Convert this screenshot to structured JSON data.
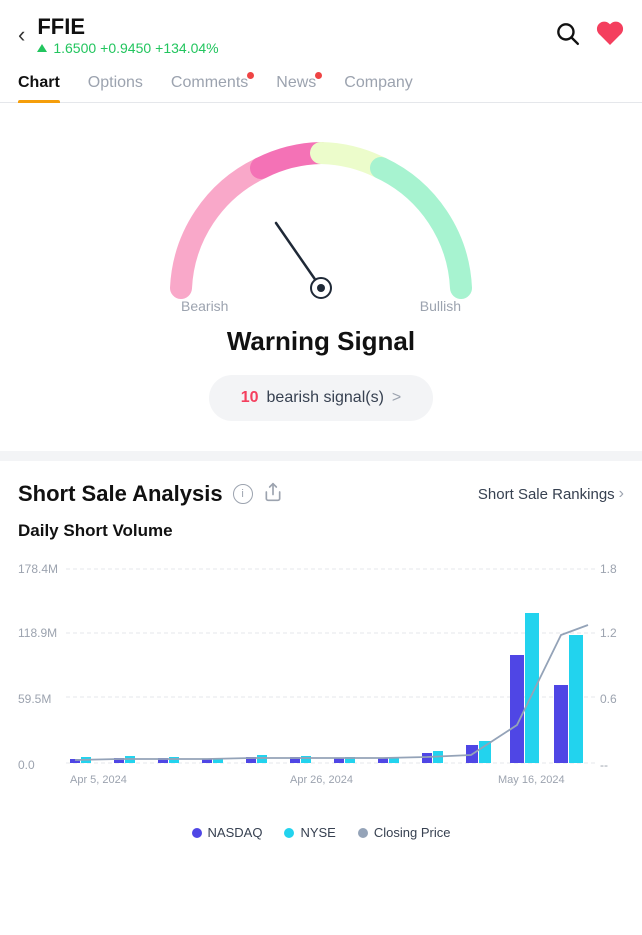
{
  "header": {
    "ticker": "FFIE",
    "price": "1.6500",
    "change": "+0.9450",
    "change_pct": "+134.04%"
  },
  "nav": {
    "tabs": [
      {
        "label": "Chart",
        "active": true,
        "dot": false
      },
      {
        "label": "Options",
        "active": false,
        "dot": false
      },
      {
        "label": "Comments",
        "active": false,
        "dot": true
      },
      {
        "label": "News",
        "active": false,
        "dot": true
      },
      {
        "label": "Company",
        "active": false,
        "dot": false
      }
    ]
  },
  "gauge": {
    "bearish_label": "Bearish",
    "bullish_label": "Bullish",
    "warning_title": "Warning Signal",
    "signal_count": "10",
    "signal_text": "bearish signal(s)",
    "signal_arrow": ">"
  },
  "short_sale": {
    "title": "Short Sale Analysis",
    "subtitle": "Daily Short Volume",
    "rankings_link": "Short Sale Rankings",
    "y_labels_left": [
      "178.4M",
      "118.9M",
      "59.5M",
      "0.0"
    ],
    "y_labels_right": [
      "1.8",
      "1.2",
      "0.6",
      "--"
    ],
    "x_labels": [
      "Apr 5, 2024",
      "Apr 26, 2024",
      "May 16, 2024"
    ],
    "legend": [
      {
        "label": "NASDAQ",
        "color": "#4f46e5"
      },
      {
        "label": "NYSE",
        "color": "#22d3ee"
      },
      {
        "label": "Closing Price",
        "color": "#94a3b8"
      }
    ]
  }
}
